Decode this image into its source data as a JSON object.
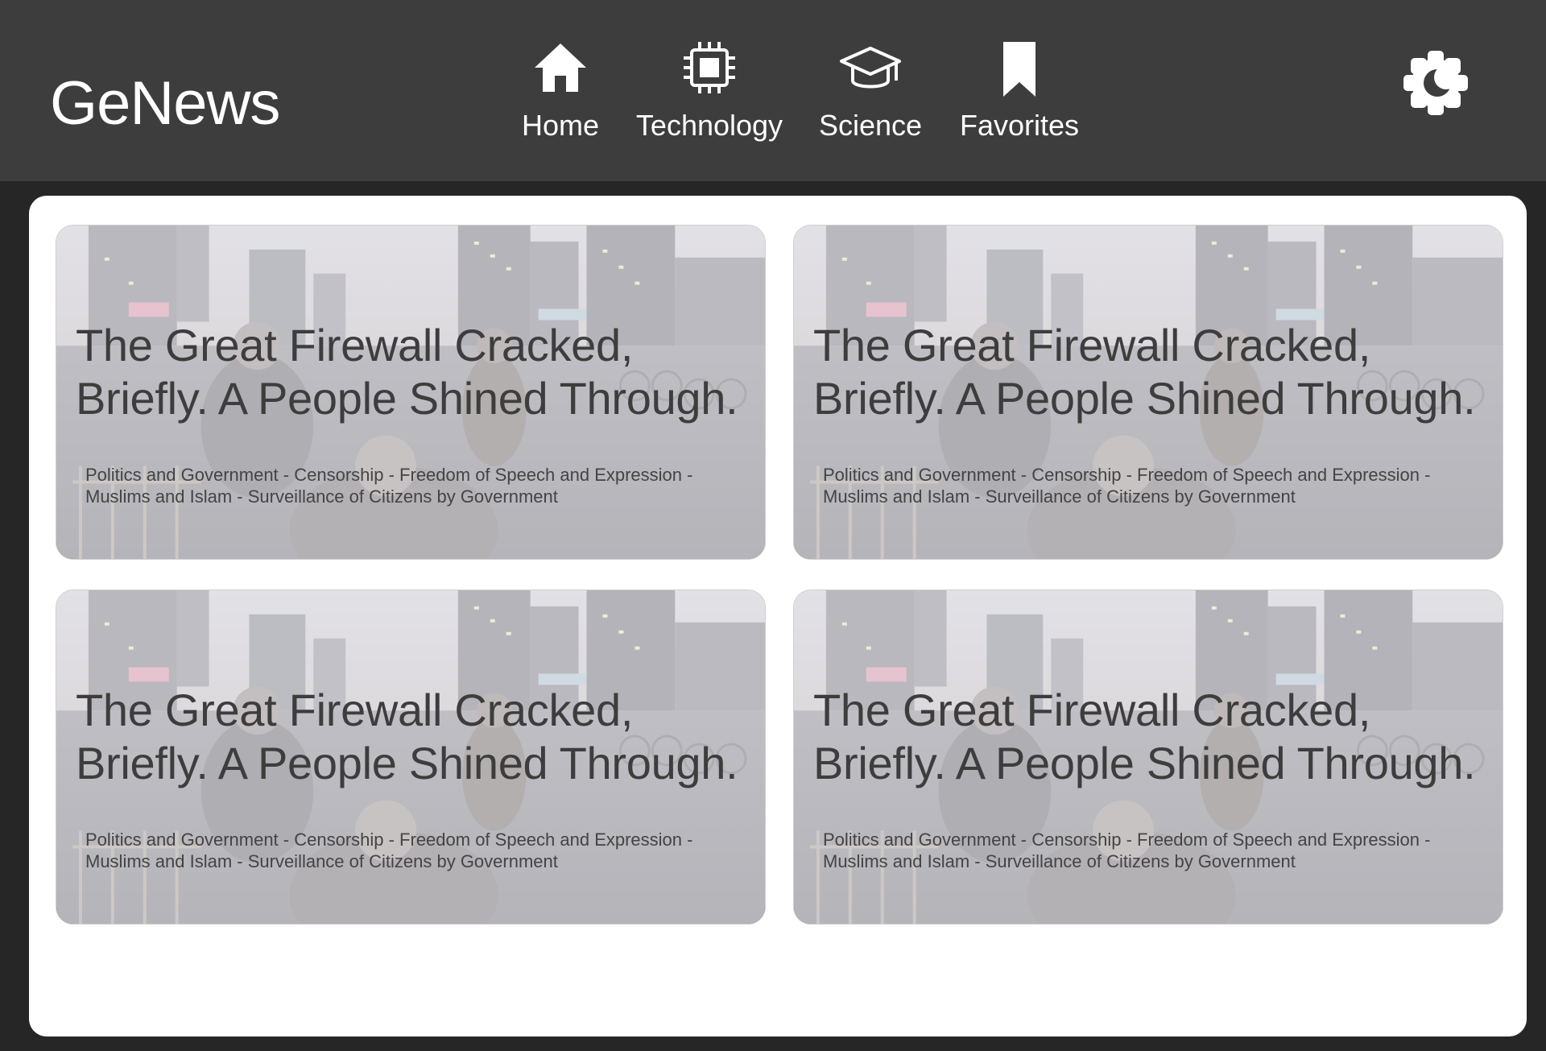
{
  "app": {
    "logo": "GeNews"
  },
  "nav": {
    "items": [
      {
        "label": "Home",
        "icon": "home-icon"
      },
      {
        "label": "Technology",
        "icon": "chip-icon"
      },
      {
        "label": "Science",
        "icon": "graduation-cap-icon"
      },
      {
        "label": "Favorites",
        "icon": "bookmark-icon"
      }
    ],
    "theme_toggle_icon": "theme-toggle-icon"
  },
  "colors": {
    "header_bg": "#3d3d3d",
    "page_bg": "#262626",
    "content_bg": "#ffffff",
    "text_light": "#ffffff",
    "card_text": "#3d3d3d"
  },
  "articles": [
    {
      "title": "The Great Firewall Cracked, Briefly. A People Shined Through.",
      "tags": "Politics and Government - Censorship - Freedom of Speech and Expression - Muslims and Islam - Surveillance of Citizens by Government"
    },
    {
      "title": "The Great Firewall Cracked, Briefly. A People Shined Through.",
      "tags": "Politics and Government - Censorship - Freedom of Speech and Expression - Muslims and Islam - Surveillance of Citizens by Government"
    },
    {
      "title": "The Great Firewall Cracked, Briefly. A People Shined Through.",
      "tags": "Politics and Government - Censorship - Freedom of Speech and Expression - Muslims and Islam - Surveillance of Citizens by Government"
    },
    {
      "title": "The Great Firewall Cracked, Briefly. A People Shined Through.",
      "tags": "Politics and Government - Censorship - Freedom of Speech and Expression - Muslims and Islam - Surveillance of Citizens by Government"
    }
  ]
}
